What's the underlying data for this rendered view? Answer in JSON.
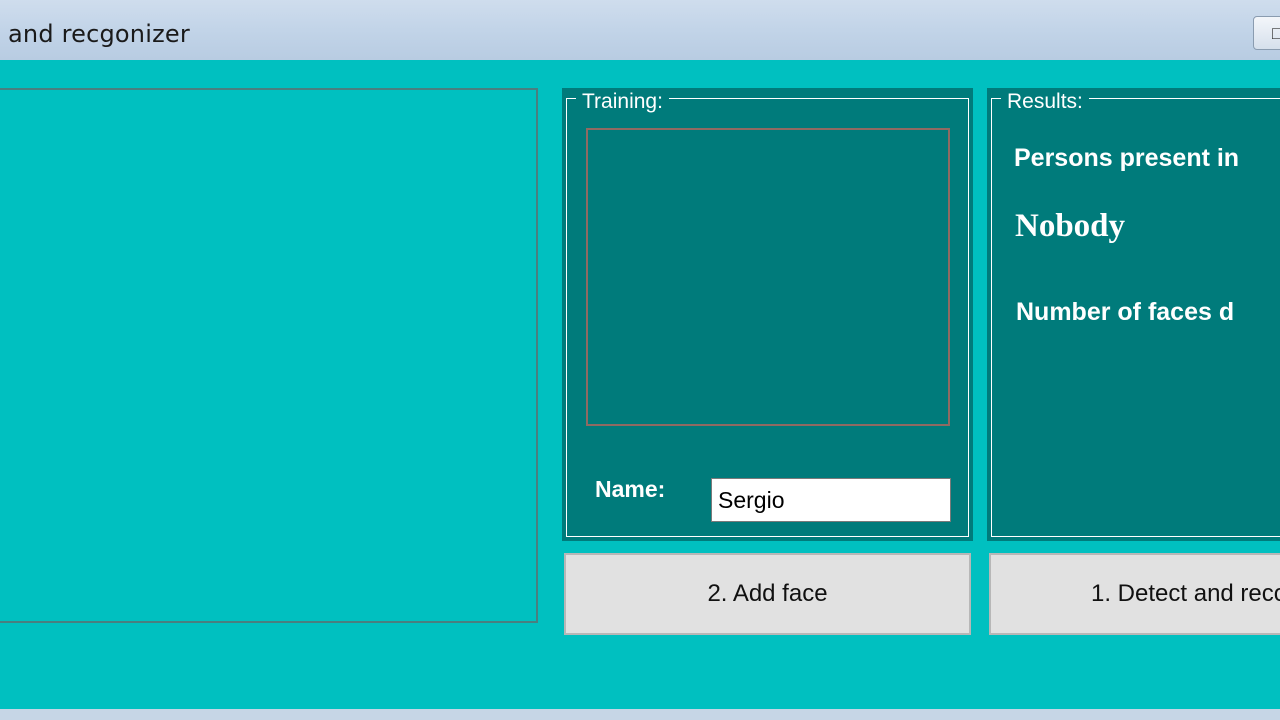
{
  "window": {
    "title": "and recgonizer",
    "title_button_glyph": "□"
  },
  "training": {
    "legend": "Training:",
    "name_label": "Name:",
    "name_value": "Sergio"
  },
  "results": {
    "legend": "Results:",
    "persons_heading": "Persons present in",
    "persons_value": "Nobody",
    "faces_detected_label": "Number of faces d"
  },
  "buttons": {
    "add_face": "2. Add face",
    "detect": "1. Detect and reco"
  },
  "colors": {
    "client_background": "#00c0c0",
    "group_background": "#007b7b",
    "button_face": "#e1e1e1"
  }
}
